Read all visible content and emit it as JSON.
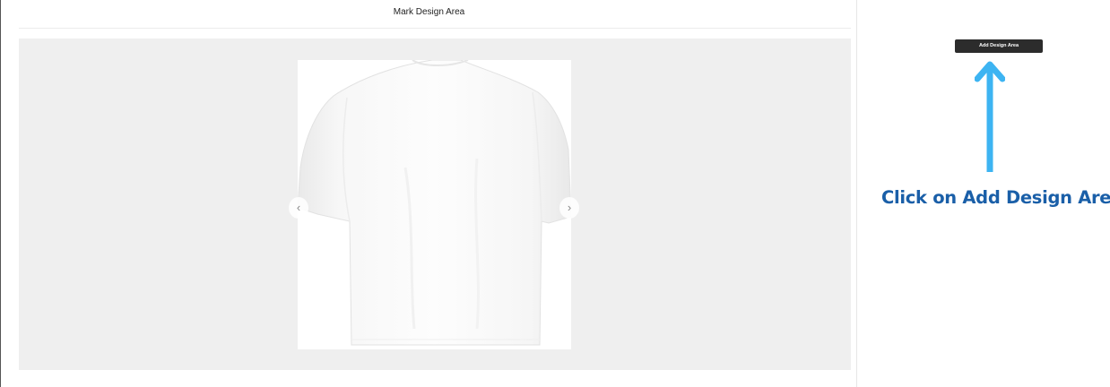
{
  "panel": {
    "title": "Mark Design Area"
  },
  "canvas": {
    "product": "white t-shirt back view",
    "prev_icon": "chevron-left-icon",
    "next_icon": "chevron-right-icon",
    "prev_glyph": "‹",
    "next_glyph": "›"
  },
  "sidebar": {
    "add_button_label": "Add Design Area",
    "instruction_text": "Click on  Add Design Area",
    "arrow_icon": "arrow-up-icon",
    "accent_color": "#3db4f2",
    "instruction_color": "#1a5fa8"
  }
}
